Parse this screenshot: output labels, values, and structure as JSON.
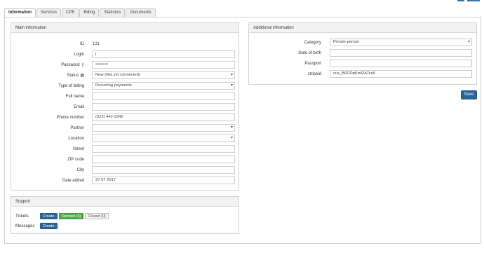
{
  "tabs": [
    "Information",
    "Services",
    "CPE",
    "Billing",
    "Statistics",
    "Documents"
  ],
  "main_info": {
    "title": "Main information",
    "id_label": "ID",
    "id_value": "131",
    "login_label": "Login",
    "login_value": "j",
    "password_label": "Password",
    "password_value": "•••••••••",
    "status_label": "Status",
    "status_value": "New (Not yet connected)",
    "billing_type_label": "Type of billing",
    "billing_type_value": "Recurring payments",
    "full_name_label": "Full name",
    "full_name_value": "",
    "email_label": "Email",
    "email_value": "",
    "phone_label": "Phone number",
    "phone_value": "(323) 442-3342",
    "partner_label": "Partner",
    "partner_value": "",
    "location_label": "Location",
    "location_value": ":",
    "street_label": "Street",
    "street_value": "",
    "zip_label": "ZIP code",
    "zip_value": "",
    "city_label": "City",
    "city_value": "",
    "date_added_label": "Date added",
    "date_added_value": "27 07 2017"
  },
  "additional_info": {
    "title": "Additional information",
    "category_label": "Category",
    "category_value": "Private person",
    "dob_label": "Date of birth",
    "dob_value": "",
    "passport_label": "Passport",
    "passport_value": "",
    "stripeid_label": "stripeid",
    "stripeid_value": "cus_B6DDpKml2ATeu5"
  },
  "save_label": "Save",
  "support": {
    "title": "Support",
    "tickets_label": "Tickets",
    "messages_label": "Messages",
    "create_label": "Create",
    "opened_label": "Opened (0)",
    "closed_label": "Closed (0)"
  },
  "icons": {
    "password": "key-icon",
    "status": "calendar-icon"
  },
  "colors": {
    "primary": "#2a6496",
    "success": "#4cae4c"
  }
}
